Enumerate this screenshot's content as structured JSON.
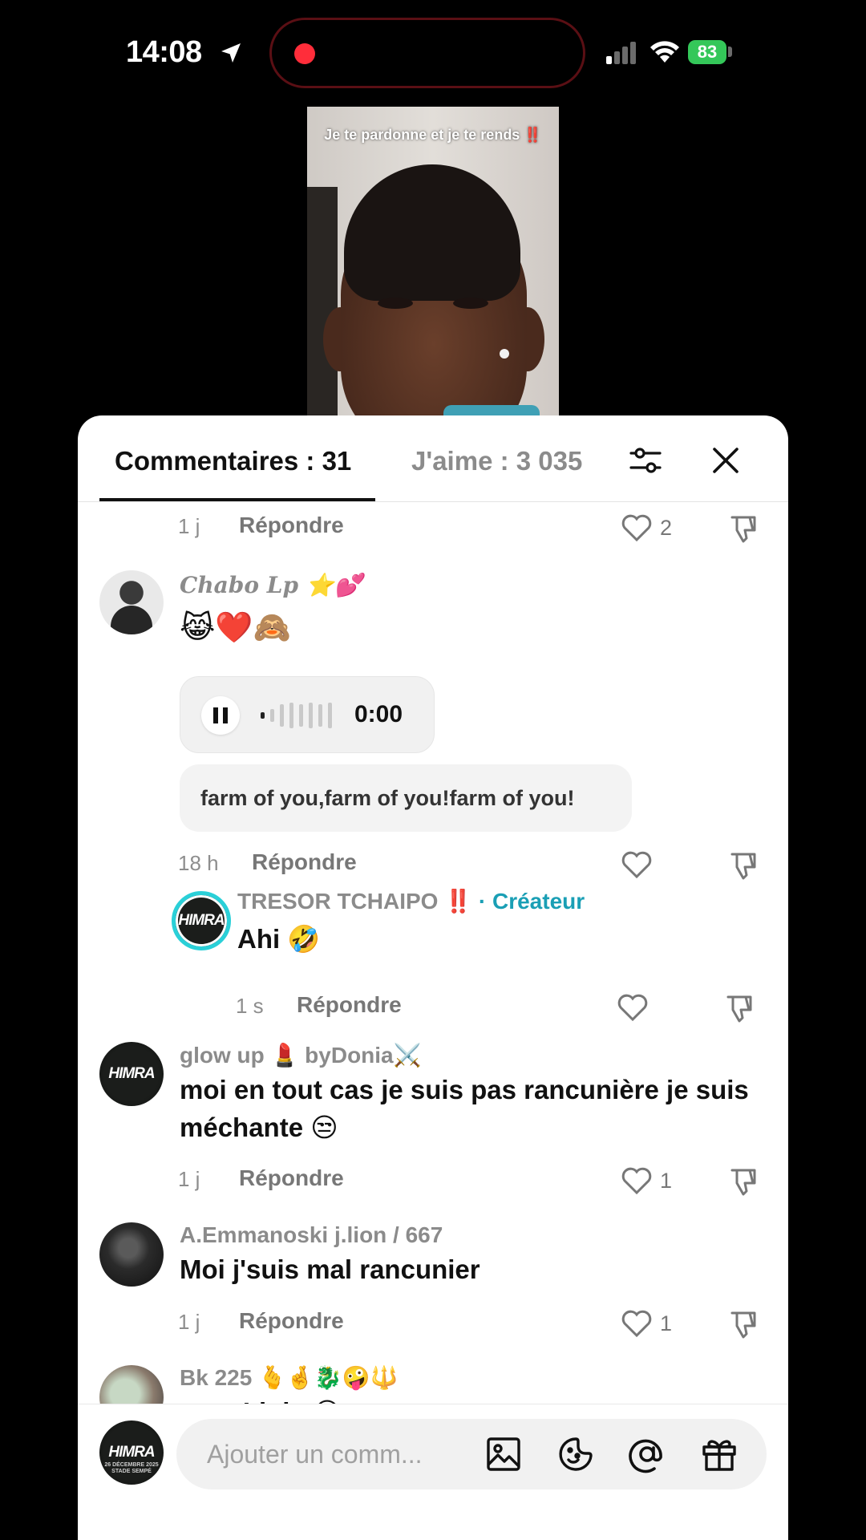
{
  "status_bar": {
    "time": "14:08",
    "battery": "83",
    "recording": true
  },
  "video": {
    "caption": "Je te pardonne et je te rends ‼️"
  },
  "tabs": {
    "comments": "Commentaires : 31",
    "likes": "J'aime : 3 035"
  },
  "comments": [
    {
      "meta": {
        "age": "1 j",
        "reply": "Répondre",
        "likes": "2"
      }
    },
    {
      "username": "Chabo Lp ⭐💕",
      "text": "😹❤️🙈",
      "voice": {
        "time": "0:00"
      },
      "translation": "farm of you,farm of you!farm of you!",
      "meta": {
        "age": "18 h",
        "reply": "Répondre",
        "likes": ""
      },
      "reply": {
        "username": "TRESOR TCHAIPO ‼️",
        "badge": "· Créateur",
        "text": "Ahi 🤣",
        "meta": {
          "age": "1 s",
          "reply": "Répondre",
          "likes": ""
        }
      }
    },
    {
      "username": "glow up 💄 byDonia⚔️",
      "text": "moi en tout cas je suis pas rancunière je suis méchante 😒",
      "meta": {
        "age": "1 j",
        "reply": "Répondre",
        "likes": "1"
      }
    },
    {
      "username": "A.Emmanoski j.lion / 667",
      "text": "Moi j'suis mal rancunier",
      "meta": {
        "age": "1 j",
        "reply": "Répondre",
        "likes": "1"
      }
    },
    {
      "username": "Bk 225 🫰🤞🐉🤪🔱",
      "text": "mon Idolo 😢"
    }
  ],
  "composer": {
    "placeholder": "Ajouter un comm..."
  },
  "avatar_text": {
    "brand": "HIMRA",
    "sub": "26 DÉCEMBRE 2025 STADE SEMPÉ"
  },
  "icons": [
    "location-arrow-icon",
    "signal-icon",
    "wifi-icon",
    "battery-icon",
    "filter-icon",
    "close-icon",
    "heart-icon",
    "dislike-icon",
    "pause-icon",
    "image-icon",
    "sticker-icon",
    "mention-icon",
    "gift-icon"
  ],
  "colors": {
    "accent": "#1a9fb5",
    "battery": "#34c759",
    "record": "#ff2d3a",
    "ring": "#2ad0d8"
  }
}
